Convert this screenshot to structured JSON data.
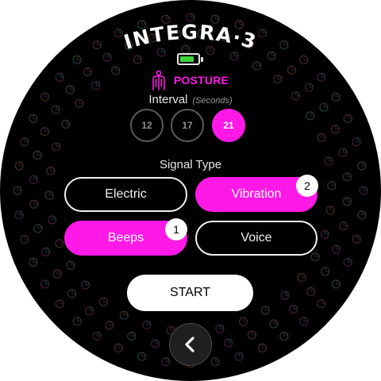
{
  "app": {
    "title": "INTEGRA·3"
  },
  "battery": {
    "level": 0.8,
    "color": "#3fd13a",
    "icon": "battery-icon"
  },
  "mode": {
    "label": "POSTURE",
    "icon": "posture-figure-icon",
    "color": "#ff19e6"
  },
  "interval": {
    "label": "Interval",
    "unit": "(Seconds)",
    "options": [
      {
        "value": "12",
        "selected": false
      },
      {
        "value": "17",
        "selected": false
      },
      {
        "value": "21",
        "selected": true
      }
    ]
  },
  "signal": {
    "title": "Signal Type",
    "options": [
      {
        "label": "Electric",
        "selected": false,
        "order": null
      },
      {
        "label": "Vibration",
        "selected": true,
        "order": "2"
      },
      {
        "label": "Beeps",
        "selected": true,
        "order": "1"
      },
      {
        "label": "Voice",
        "selected": false,
        "order": null
      }
    ]
  },
  "actions": {
    "start_label": "START",
    "back_icon": "chevron-left-icon"
  },
  "colors": {
    "accent": "#ff19e6",
    "background": "#000000",
    "text": "#ffffff"
  }
}
